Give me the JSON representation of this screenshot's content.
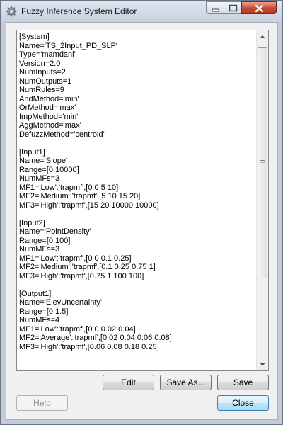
{
  "window": {
    "title": "Fuzzy Inference System Editor",
    "app_icon": "gear-icon",
    "controls": [
      "minimize-icon",
      "maximize-icon",
      "close-icon"
    ]
  },
  "editor": {
    "lines": [
      "[System]",
      "Name='TS_2Input_PD_SLP'",
      "Type='mamdani'",
      "Version=2.0",
      "NumInputs=2",
      "NumOutputs=1",
      "NumRules=9",
      "AndMethod='min'",
      "OrMethod='max'",
      "ImpMethod='min'",
      "AggMethod='max'",
      "DefuzzMethod='centroid'",
      "",
      "[Input1]",
      "Name='Slope'",
      "Range=[0 10000]",
      "NumMFs=3",
      "MF1='Low':'trapmf',[0 0 5 10]",
      "MF2='Medium':'trapmf',[5 10 15 20]",
      "MF3='High':'trapmf',[15 20 10000 10000]",
      "",
      "[Input2]",
      "Name='PointDensity'",
      "Range=[0 100]",
      "NumMFs=3",
      "MF1='Low':'trapmf',[0 0 0.1 0.25]",
      "MF2='Medium':'trapmf',[0.1 0.25 0.75 1]",
      "MF3='High':'trapmf',[0.75 1 100 100]",
      "",
      "[Output1]",
      "Name='ElevUncertainty'",
      "Range=[0 1.5]",
      "NumMFs=4",
      "MF1='Low':'trapmf',[0 0 0.02 0.04]",
      "MF2='Average':'trapmf',[0.02 0.04 0.06 0.08]",
      "MF3='High':'trapmf',[0.06 0.08 0.18 0.25]"
    ],
    "scrollbar": {
      "up_icon": "arrow-up-icon",
      "down_icon": "arrow-down-icon",
      "grip_icon": "grip-icon"
    }
  },
  "buttons": {
    "edit": "Edit",
    "save_as": "Save As...",
    "save": "Save",
    "help": "Help",
    "close": "Close"
  },
  "colors": {
    "title_bar": "#c7d0dd",
    "close_button": "#c64a32",
    "dialog_background": "#f0f0f0",
    "default_button_border": "#3c7fb1"
  }
}
